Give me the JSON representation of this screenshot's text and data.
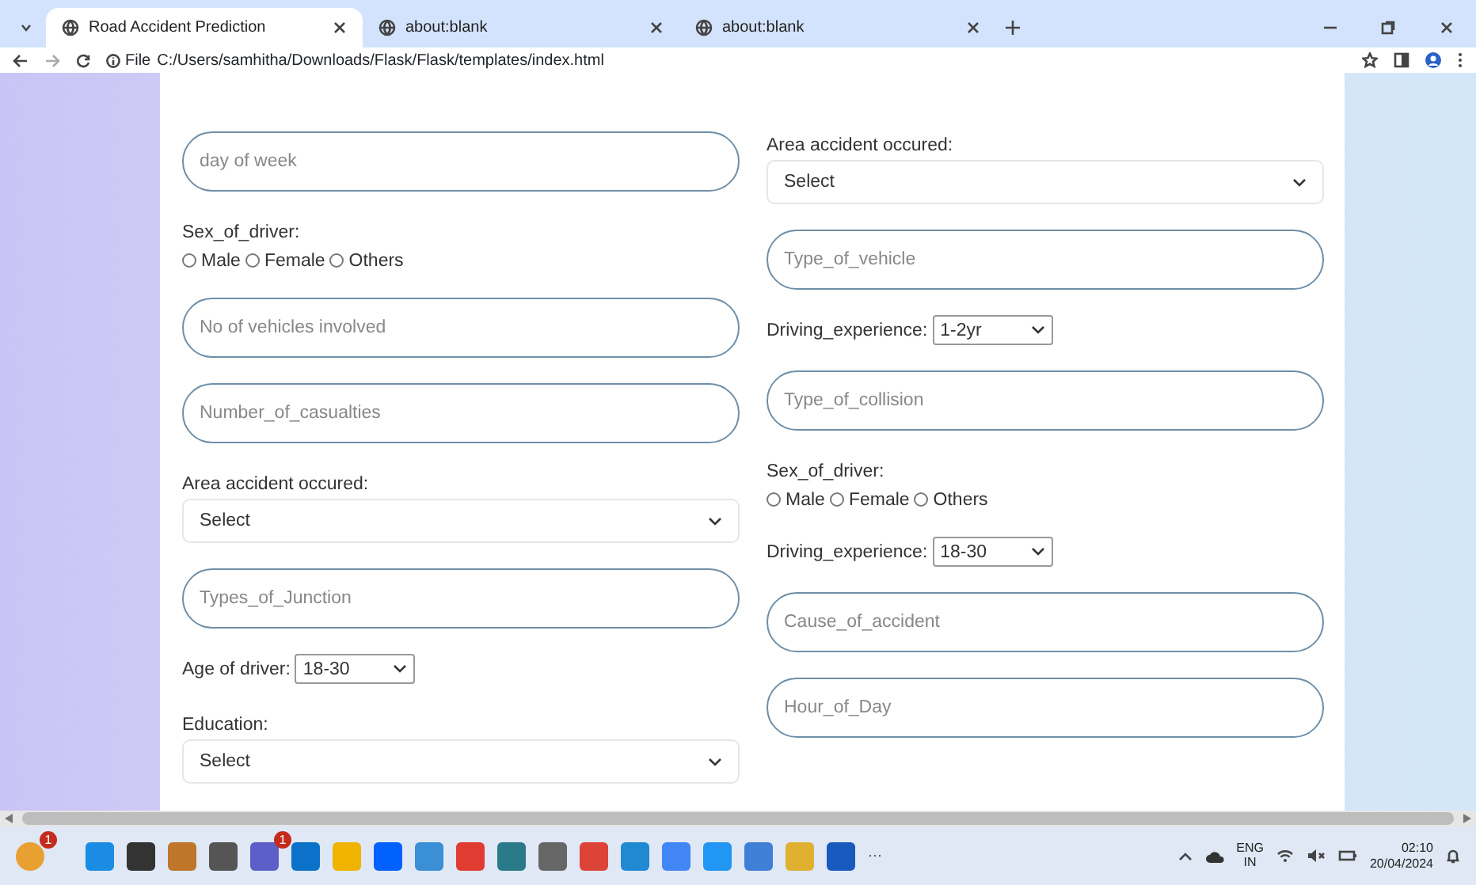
{
  "browser": {
    "tabs": [
      {
        "title": "Road Accident Prediction",
        "selected": true
      },
      {
        "title": "about:blank",
        "selected": false
      },
      {
        "title": "about:blank",
        "selected": false
      }
    ],
    "address": {
      "scheme": "File",
      "url": "C:/Users/samhitha/Downloads/Flask/Flask/templates/index.html"
    }
  },
  "form": {
    "columns": [
      [
        {
          "kind": "field",
          "placeholder": "day of week"
        },
        {
          "kind": "radios",
          "label": "Sex_of_driver:",
          "options": [
            {
              "label": "Male",
              "checked": false
            },
            {
              "label": "Female",
              "checked": false
            },
            {
              "label": "Others",
              "checked": false
            }
          ]
        },
        {
          "kind": "field",
          "placeholder": "No of vehicles involved"
        },
        {
          "kind": "field",
          "placeholder": "Number_of_casualties"
        },
        {
          "kind": "select",
          "label": "Area accident occured:",
          "value": "Select"
        },
        {
          "kind": "field",
          "placeholder": "Types_of_Junction"
        },
        {
          "kind": "inline_select",
          "label": "Age of driver:",
          "value": "18-30"
        },
        {
          "kind": "select",
          "label": "Education:",
          "value": "Select"
        }
      ],
      [
        {
          "kind": "select",
          "label": "Area accident occured:",
          "value": "Select"
        },
        {
          "kind": "field",
          "placeholder": "Type_of_vehicle"
        },
        {
          "kind": "inline_select",
          "label": "Driving_experience:",
          "value": "1-2yr"
        },
        {
          "kind": "field",
          "placeholder": "Type_of_collision"
        },
        {
          "kind": "radios",
          "label": "Sex_of_driver:",
          "options": [
            {
              "label": "Male",
              "checked": false
            },
            {
              "label": "Female",
              "checked": false
            },
            {
              "label": "Others",
              "checked": false
            }
          ]
        },
        {
          "kind": "inline_select",
          "label": "Driving_experience:",
          "value": "18-30"
        },
        {
          "kind": "field",
          "placeholder": "Cause_of_accident"
        },
        {
          "kind": "field",
          "placeholder": "Hour_of_Day"
        }
      ]
    ]
  },
  "taskbar": {
    "badges": [
      "1",
      "1"
    ],
    "more": "···",
    "language": "ENG",
    "region": "IN",
    "time": "02:10",
    "date": "20/04/2024"
  }
}
